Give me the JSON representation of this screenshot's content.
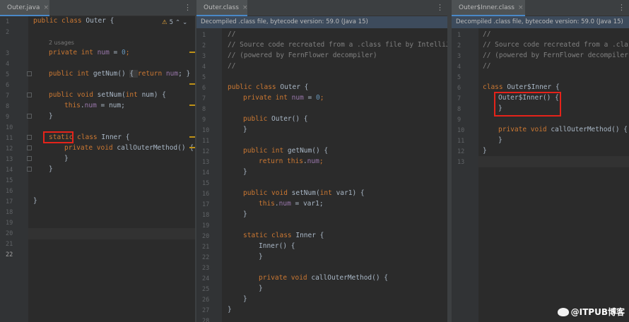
{
  "pane1": {
    "tab": {
      "label": "Outer.java",
      "close": "×"
    },
    "inspection": {
      "icon": "⚠",
      "count": "5",
      "up": "⌃",
      "down": "⌄"
    },
    "line_numbers": [
      "1",
      "2",
      "3",
      "4",
      "5",
      "6",
      "7",
      "8",
      "9",
      "10",
      "11",
      "12",
      "13",
      "14",
      "15",
      "16",
      "17",
      "18",
      "19",
      "20",
      "21",
      "22"
    ],
    "code": {
      "l1_kw": "public class",
      "l1_rest": " Outer {",
      "usages": "2 usages",
      "l3_kw": "private int",
      "l3_field": "num",
      "l3_eq": " = ",
      "l3_num": "0",
      "l3_end": ";",
      "l5_kw": "public int",
      "l5_name": " getNum",
      "l5_paren": "() ",
      "l5_body_open": "{ ",
      "l5_ret": "return",
      "l5_field": " num",
      "l5_close": "; }",
      "l9_kw": "public void",
      "l9_rest": " setNum(",
      "l9_int": "int",
      "l9_params": " num) {",
      "l10_this": "this",
      "l10_dot": ".",
      "l10_field": "num",
      "l10_rest": " = num;",
      "l11": "}",
      "l13_static": "static",
      "l13_class": " class",
      "l13_rest": " Inner {",
      "l14_kw": "private void",
      "l14_rest": " callOuterMethod() {",
      "l15": "}",
      "l16": "}",
      "l19": "}"
    }
  },
  "pane2": {
    "tab": {
      "label": "Outer.class",
      "close": "×"
    },
    "banner": "Decompiled .class file, bytecode version: 59.0 (Java 15)",
    "line_numbers": [
      "1",
      "2",
      "3",
      "4",
      "5",
      "6",
      "7",
      "8",
      "9",
      "10",
      "11",
      "12",
      "13",
      "14",
      "15",
      "16",
      "17",
      "18",
      "19",
      "20",
      "21",
      "22",
      "23",
      "24",
      "25",
      "26",
      "27",
      "28"
    ],
    "code": {
      "l1": "//",
      "l2": "// Source code recreated from a .class file by IntelliJ ID",
      "l3": "// (powered by FernFlower decompiler)",
      "l4": "//",
      "l6_kw": "public class",
      "l6_rest": " Outer {",
      "l7_kw": "private int",
      "l7_field": " num",
      "l7_eq": " = ",
      "l7_num": "0",
      "l7_end": ";",
      "l9_kw": "public",
      "l9_rest": " Outer() {",
      "l10": "}",
      "l12_kw": "public int",
      "l12_rest": " getNum() {",
      "l13_kw": "return",
      "l13_this": " this",
      "l13_dot": ".",
      "l13_field": "num",
      "l13_end": ";",
      "l14": "}",
      "l16_kw": "public void",
      "l16_rest": " setNum(",
      "l16_int": "int",
      "l16_params": " var1) {",
      "l17_this": "this",
      "l17_dot": ".",
      "l17_field": "num",
      "l17_rest": " = var1;",
      "l18": "}",
      "l20_kw": "static class",
      "l20_rest": " Inner {",
      "l21": "Inner() {",
      "l22": "}",
      "l24_kw": "private void",
      "l24_rest": " callOuterMethod() {",
      "l25": "}",
      "l26": "}",
      "l27": "}"
    }
  },
  "pane3": {
    "tab": {
      "label": "Outer$Inner.class",
      "close": "×"
    },
    "banner": "Decompiled .class file, bytecode version: 59.0 (Java 15)",
    "line_numbers": [
      "1",
      "2",
      "3",
      "4",
      "5",
      "6",
      "7",
      "8",
      "9",
      "10",
      "11",
      "12",
      "13"
    ],
    "code": {
      "l1": "//",
      "l2": "// Source code recreated from a .class",
      "l3": "// (powered by FernFlower decompiler)",
      "l4": "//",
      "l6_kw": "class",
      "l6_rest": " Outer$Inner {",
      "l7": "Outer$Inner() {",
      "l8": "}",
      "l10_kw": "private void",
      "l10_rest": " callOuterMethod() {",
      "l11": "}",
      "l12": "}"
    }
  },
  "kebab_icon": "⋮",
  "watermark": "@ITPUB博客",
  "colors": {
    "keyword": "#cc7832",
    "field": "#9876aa",
    "number": "#6897bb",
    "comment": "#808080",
    "highlight_box": "#e5231a",
    "tab_underline": "#4a88c7"
  }
}
